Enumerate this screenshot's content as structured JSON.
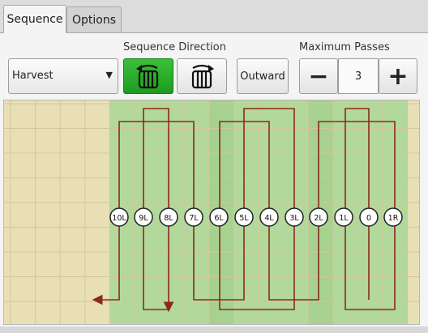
{
  "tabs": [
    {
      "label": "Sequence",
      "active": true
    },
    {
      "label": "Options",
      "active": false
    }
  ],
  "controls": {
    "mode_select": {
      "value": "Harvest"
    },
    "sequence_direction": {
      "label": "Sequence Direction",
      "selected": "left-icon"
    },
    "order_button": {
      "label": "Outward"
    },
    "max_passes": {
      "label": "Maximum Passes",
      "value": "3",
      "minus_label": "−",
      "plus_label": "+"
    }
  },
  "colors": {
    "field_background": "#e9dfb6",
    "selected_band": "#b3d89c",
    "darker_band": "#9fcd86",
    "path_line": "#8b2a1a",
    "selected_button": "#2db02d"
  },
  "passes": {
    "labels": [
      "10L",
      "9L",
      "8L",
      "7L",
      "6L",
      "5L",
      "4L",
      "3L",
      "2L",
      "1L",
      "0",
      "1R"
    ]
  }
}
